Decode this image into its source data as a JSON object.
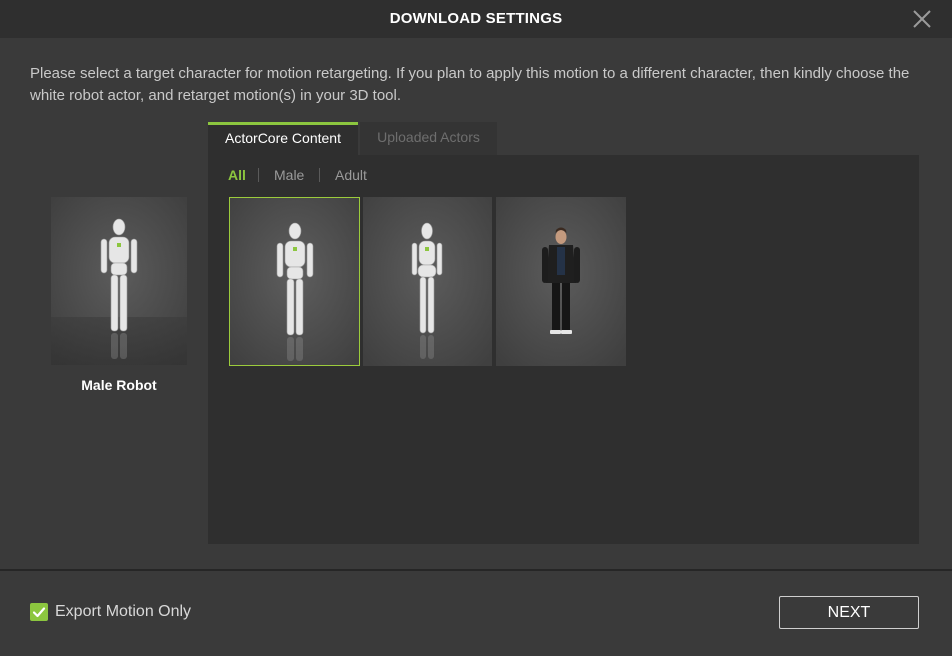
{
  "dialog": {
    "title": "DOWNLOAD SETTINGS",
    "description": "Please select a target character for motion retargeting. If you plan to apply this motion to a different character, then kindly choose the white robot actor, and retarget motion(s) in your 3D tool."
  },
  "selected_character": {
    "name": "Male Robot"
  },
  "tabs": [
    {
      "label": "ActorCore Content",
      "active": true
    },
    {
      "label": "Uploaded Actors",
      "active": false
    }
  ],
  "filters": [
    {
      "label": "All",
      "active": true
    },
    {
      "label": "Male",
      "active": false
    },
    {
      "label": "Adult",
      "active": false
    }
  ],
  "characters": [
    {
      "type": "male-robot",
      "selected": true
    },
    {
      "type": "female-robot",
      "selected": false
    },
    {
      "type": "man-dark-jacket",
      "selected": false
    }
  ],
  "footer": {
    "export_label": "Export Motion Only",
    "export_checked": true,
    "next_label": "NEXT"
  },
  "colors": {
    "accent": "#8cc63f",
    "background": "#3a3a3a",
    "panel": "#2f2f2f"
  }
}
